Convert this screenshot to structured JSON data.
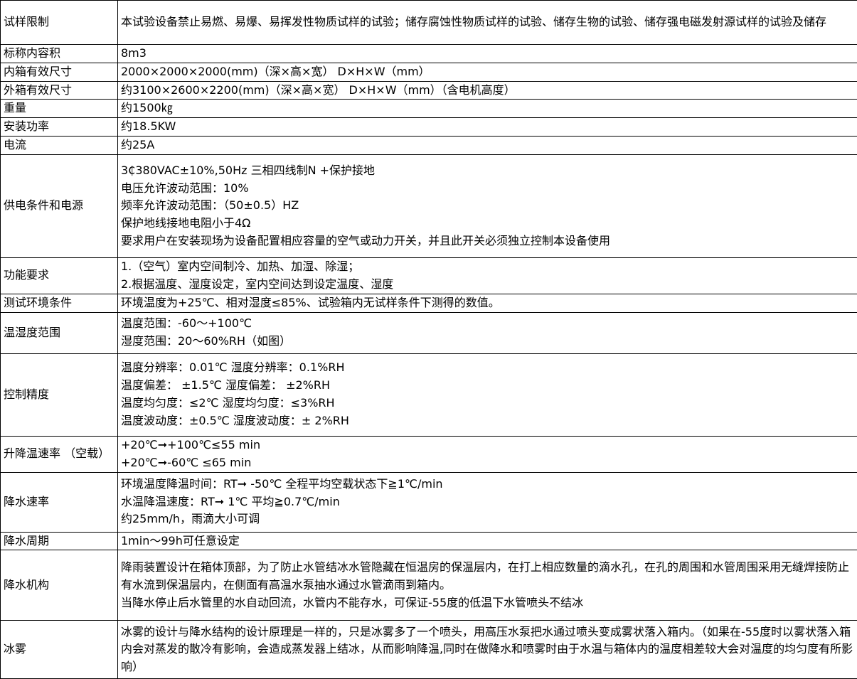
{
  "rows": [
    {
      "label": "试样限制",
      "lines": [
        "本试验设备禁止易燃、易爆、易挥发性物质试样的试验；储存腐蚀性物质试样的试验、储存生物的试验、储存强电磁发射源试样的试验及储存"
      ]
    },
    {
      "label": "标称内容积",
      "lines": [
        "8m3"
      ]
    },
    {
      "label": "内箱有效尺寸",
      "lines": [
        "2000×2000×2000(mm)（深×高×宽） D×H×W（mm）"
      ]
    },
    {
      "label": "外箱有效尺寸",
      "lines": [
        "约3100×2600×2200(mm)（深×高×宽） D×H×W（mm）（含电机高度）"
      ]
    },
    {
      "label": "重量",
      "lines": [
        "约1500㎏"
      ]
    },
    {
      "label": "安装功率",
      "lines": [
        "约18.5KW"
      ]
    },
    {
      "label": "电流",
      "lines": [
        "约25A"
      ]
    },
    {
      "label": "供电条件和电源",
      "lines": [
        "3₵380VAC±10%,50Hz 三相四线制N +保护接地",
        "电压允许波动范围：10%",
        "频率允许波动范围：（50±0.5）HZ",
        "保护地线接地电阻小于4Ω",
        "要求用户在安装现场为设备配置相应容量的空气或动力开关，并且此开关必须独立控制本设备使用"
      ]
    },
    {
      "label": "功能要求",
      "lines": [
        "1.（空气）室内空间制冷、加热、加湿、除湿；",
        "2.根据温度、湿度设定，室内空间达到设定温度、湿度"
      ]
    },
    {
      "label": "测试环境条件",
      "lines": [
        "环境温度为+25℃、相对湿度≤85%、试验箱内无试样条件下测得的数值。"
      ]
    },
    {
      "label": "温湿度范围",
      "lines": [
        "温度范围：-60～+100℃",
        "湿度范围：20～60%RH（如图）"
      ]
    },
    {
      "label": "控制精度",
      "lines": [
        "温度分辨率：0.01℃ 湿度分辨率：0.1%RH",
        "温度偏差： ±1.5℃ 湿度偏差： ±2%RH",
        "温度均匀度：≤2℃ 湿度均匀度：≤3%RH",
        "温度波动度：±0.5℃ 湿度波动度：± 2%RH"
      ]
    },
    {
      "label": "升降温速率 （空载）",
      "lines": [
        "+20℃➞+100℃≤55 min",
        "+20℃➞-60℃ ≤65 min"
      ]
    },
    {
      "label": "降水速率",
      "lines": [
        "环境温度降温时间：RT➞ -50℃ 全程平均空载状态下≧1℃/min",
        "水温降温速度：RT➞ 1℃ 平均≧0.7℃/min",
        "约25mm/h，雨滴大小可调"
      ]
    },
    {
      "label": "降水周期",
      "lines": [
        "1min～99h可任意设定"
      ]
    },
    {
      "label": "降水机构",
      "lines": [
        "降雨装置设计在箱体顶部，为了防止水管结冰水管隐藏在恒温房的保温层内，在打上相应数量的滴水孔，在孔的周围和水管周围采用无缝焊接防止有水流到保温层内，在侧面有高温水泵抽水通过水管滴雨到箱内。",
        "当降水停止后水管里的水自动回流，水管内不能存水，可保证-55度的低温下水管喷头不结冰"
      ]
    },
    {
      "label": "冰雾",
      "lines": [
        "冰雾的设计与降水结构的设计原理是一样的，只是冰雾多了一个喷头，用高压水泵把水通过喷头变成雾状落入箱内。（如果在-55度时以雾状落入箱内会对蒸发的散冷有影响，会造成蒸发器上结冰，从而影响降温,同时在做降水和喷雾时由于水温与箱体内的温度相差较大会对温度的均匀度有所影响）"
      ]
    }
  ]
}
